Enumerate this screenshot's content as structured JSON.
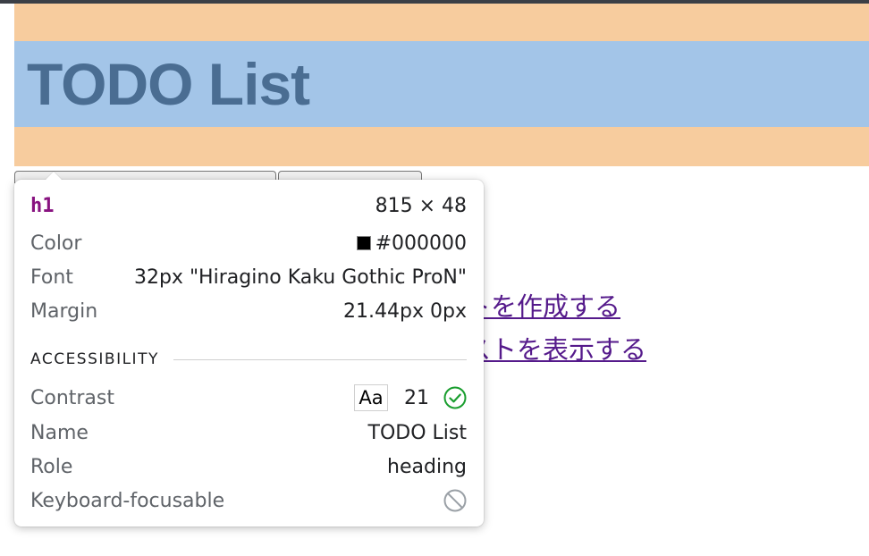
{
  "page": {
    "title": "TODO List",
    "links": [
      {
        "label": "トを作成する"
      },
      {
        "label": "ストを表示する"
      }
    ]
  },
  "inspector": {
    "tag": "h1",
    "dimensions": "815 × 48",
    "properties": [
      {
        "label": "Color",
        "value": "#000000",
        "swatch": "#000000"
      },
      {
        "label": "Font",
        "value": "32px \"Hiragino Kaku Gothic ProN\""
      },
      {
        "label": "Margin",
        "value": "21.44px 0px"
      }
    ],
    "accessibility": {
      "header": "ACCESSIBILITY",
      "contrast": {
        "label": "Contrast",
        "aa": "Aa",
        "value": "21",
        "icon": "check-circle-icon",
        "icon_color": "#1a9e2f"
      },
      "name": {
        "label": "Name",
        "value": "TODO List"
      },
      "role": {
        "label": "Role",
        "value": "heading"
      },
      "keyboard": {
        "label": "Keyboard-focusable",
        "icon": "not-allowed-icon",
        "icon_color": "#9aa0a6"
      }
    }
  },
  "colors": {
    "margin_overlay": "#f7cc9e",
    "content_overlay": "#a3c5e8",
    "link": "#551a8b",
    "tag": "#881280"
  }
}
